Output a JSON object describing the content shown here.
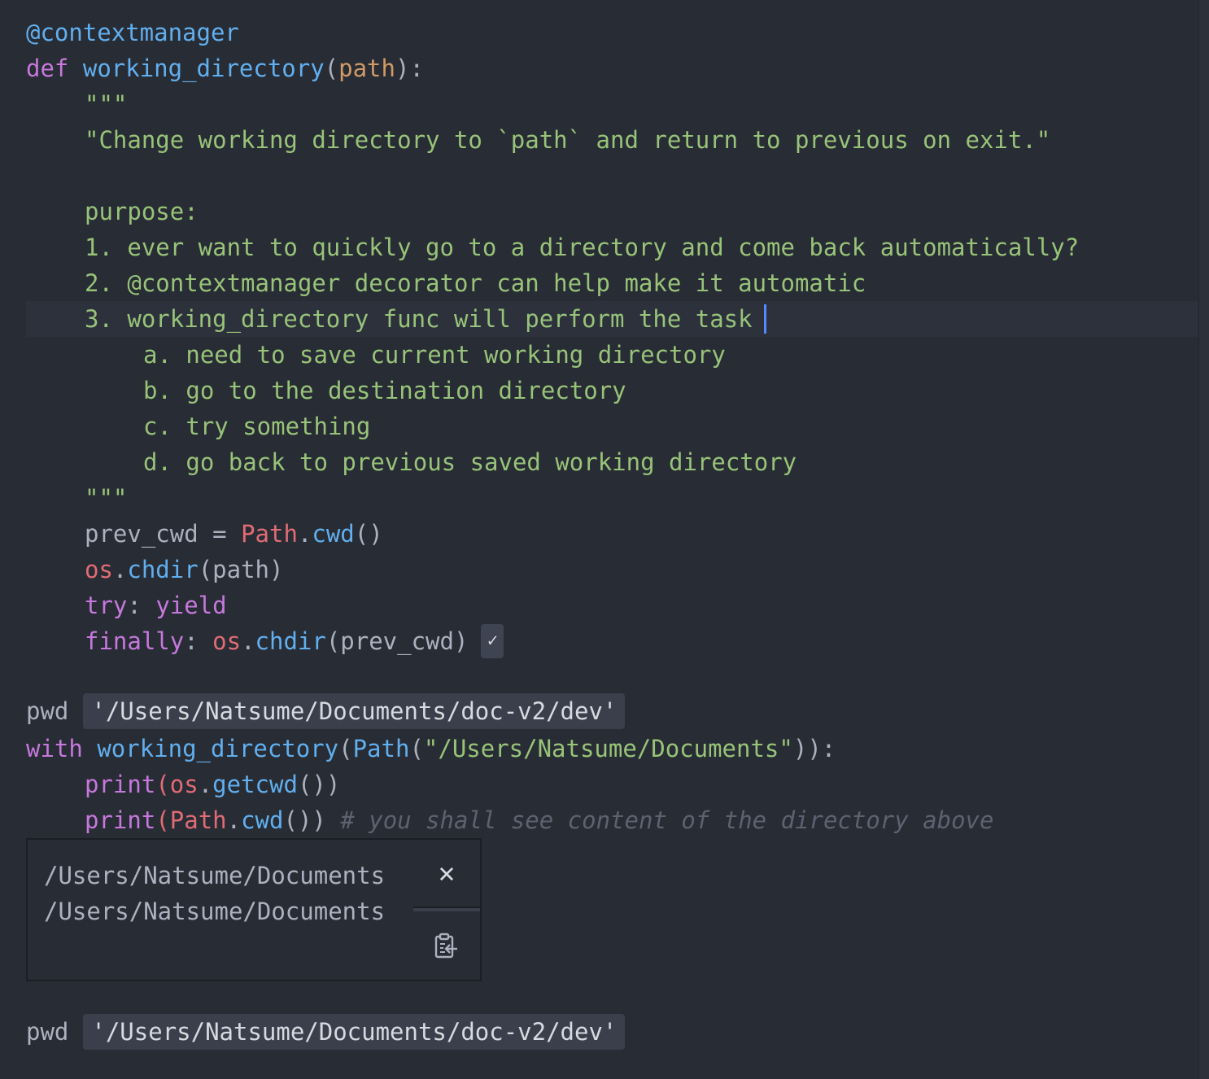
{
  "code": {
    "decorator": "@contextmanager",
    "def_kw": "def",
    "func_name": "working_directory",
    "open_paren": "(",
    "param": "path",
    "close_colon": "):",
    "doc_quote": "\"\"\"",
    "doc_summary": "\"Change working directory to `path` and return to previous on exit.\"",
    "purpose": "purpose:",
    "item1": "1. ever want to quickly go to a directory and come back automatically?",
    "item2": "2. @contextmanager decorator can help make it automatic",
    "item3": "3. working_directory func will perform the task",
    "item_a": "a. need to save current working directory",
    "item_b": "b. go to the destination directory",
    "item_c": "c. try something",
    "item_d": "d. go back to previous saved working directory",
    "prev_cwd_var": "prev_cwd = ",
    "path_obj": "Path",
    "dot": ".",
    "cwd_fn": "cwd",
    "empty_call": "()",
    "os_obj": "os",
    "chdir_fn": "chdir",
    "chdir_arg": "(path)",
    "try_kw": "try",
    "colon_space": ": ",
    "yield_kw": "yield",
    "finally_kw": "finally",
    "chdir_prev_arg": "(prev_cwd)",
    "check_mark": "✓"
  },
  "cell2": {
    "pwd_label": "pwd",
    "pwd_value": "'/Users/Natsume/Documents/doc-v2/dev'",
    "with_kw": "with",
    "space": " ",
    "func_name": "working_directory",
    "open_paren": "(",
    "path_obj": "Path",
    "path_open": "(",
    "path_str": "\"/Users/Natsume/Documents\"",
    "close_paren_colon": ")):",
    "print_fn": "print",
    "os_obj": "os",
    "getcwd_fn": "getcwd",
    "close2": "())",
    "cwd_fn": "cwd",
    "comment": " # you shall see content of the directory above"
  },
  "output": {
    "lines": "/Users/Natsume/Documents\n/Users/Natsume/Documents",
    "close_icon": "✕"
  },
  "cell3": {
    "pwd_label": "pwd",
    "pwd_value": "'/Users/Natsume/Documents/doc-v2/dev'"
  },
  "colors": {
    "background": "#282c34",
    "keyword": "#c678dd",
    "function": "#61afef",
    "string": "#98c379",
    "parameter": "#d19a66",
    "object": "#e06c75",
    "cursor": "#528bff"
  }
}
